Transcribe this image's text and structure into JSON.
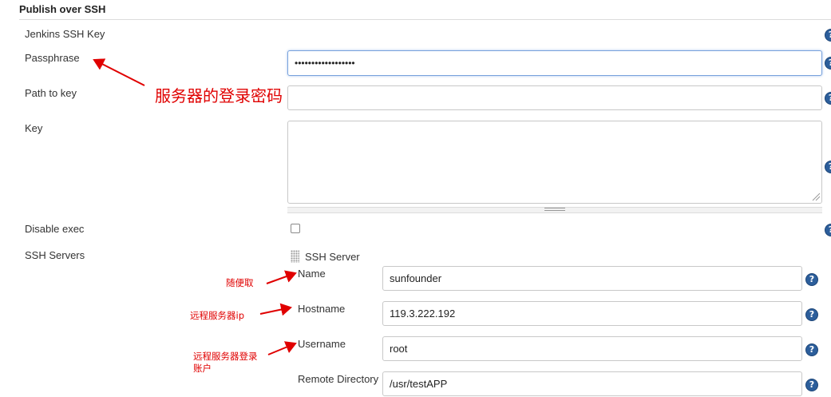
{
  "section": {
    "title": "Publish over SSH"
  },
  "labels": {
    "jenkins_ssh_key": "Jenkins SSH Key",
    "passphrase": "Passphrase",
    "path_to_key": "Path to key",
    "key": "Key",
    "disable_exec": "Disable exec",
    "ssh_servers": "SSH Servers"
  },
  "fields": {
    "passphrase": "••••••••••••••••••",
    "path_to_key": "",
    "key": "",
    "disable_exec_checked": false
  },
  "ssh_server": {
    "heading": "SSH Server",
    "name_label": "Name",
    "name_value": "sunfounder",
    "hostname_label": "Hostname",
    "hostname_value": "119.3.222.192",
    "username_label": "Username",
    "username_value": "root",
    "remote_dir_label": "Remote Directory",
    "remote_dir_value": "/usr/testAPP"
  },
  "help_glyph": "?",
  "annotations": {
    "passphrase_note": "服务器的登录密码",
    "name_note": "随便取",
    "hostname_note": "远程服务器ip",
    "username_note_line1": "远程服务器登录",
    "username_note_line2": "账户"
  },
  "colors": {
    "annotation": "#e00000",
    "help_icon": "#2c5e9b",
    "focus_border": "#78a2dc"
  }
}
